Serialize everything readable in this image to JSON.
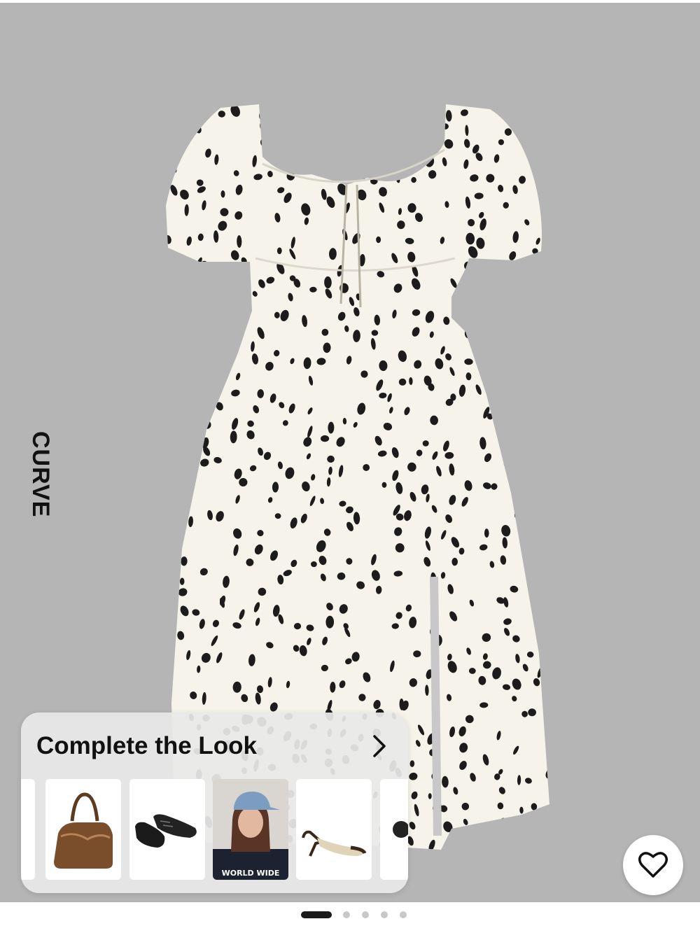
{
  "product": {
    "brand_label": "CURVE",
    "image_icon": "dalmatian-print-dress"
  },
  "complete_the_look": {
    "title": "Complete the Look",
    "chevron_icon": "chevron-right-icon",
    "items": [
      {
        "name": "brown-shoulder-bag",
        "icon": "bag-icon"
      },
      {
        "name": "black-lace-up-flats",
        "icon": "shoes-icon"
      },
      {
        "name": "denim-cap-model",
        "icon": "model-photo",
        "print_text": "WORLD WIDE"
      },
      {
        "name": "slingback-kitten-heels",
        "icon": "heels-icon"
      }
    ]
  },
  "favorite": {
    "icon": "heart-icon"
  },
  "carousel": {
    "pages": 5,
    "active_index": 0
  },
  "colors": {
    "background": "#b5b5b5",
    "dress": "#f6f3ea",
    "spots": "#1c1c1c"
  }
}
